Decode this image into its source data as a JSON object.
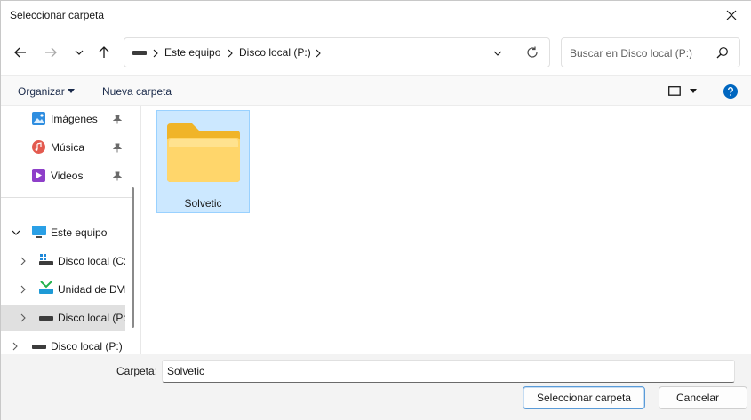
{
  "window": {
    "title": "Seleccionar carpeta"
  },
  "address": {
    "crumbs": [
      "Este equipo",
      "Disco local (P:)"
    ]
  },
  "search": {
    "placeholder": "Buscar en Disco local (P:)"
  },
  "toolbar": {
    "organize": "Organizar",
    "new_folder": "Nueva carpeta"
  },
  "sidebar": {
    "items": [
      {
        "label": "Imágenes",
        "icon": "pictures-icon",
        "pinned": true
      },
      {
        "label": "Música",
        "icon": "music-icon",
        "pinned": true
      },
      {
        "label": "Videos",
        "icon": "videos-icon",
        "pinned": true
      },
      {
        "label": "Este equipo",
        "icon": "this-pc-icon",
        "expanded": true
      },
      {
        "label": "Disco local (C:)",
        "icon": "windows-drive-icon"
      },
      {
        "label": "Unidad de DVD",
        "icon": "dvd-drive-icon"
      },
      {
        "label": "Disco local (P:)",
        "icon": "drive-icon",
        "selected": true
      },
      {
        "label": "Disco local (P:)",
        "icon": "drive-icon"
      }
    ]
  },
  "content": {
    "items": [
      {
        "name": "Solvetic",
        "icon": "folder-icon",
        "selected": true
      }
    ]
  },
  "footer": {
    "folder_label": "Carpeta:",
    "folder_value": "Solvetic",
    "select_button": "Seleccionar carpeta",
    "cancel_button": "Cancelar"
  },
  "colors": {
    "accent": "#0067c0",
    "selection": "#cce8ff",
    "folder": "#ffc83d"
  }
}
